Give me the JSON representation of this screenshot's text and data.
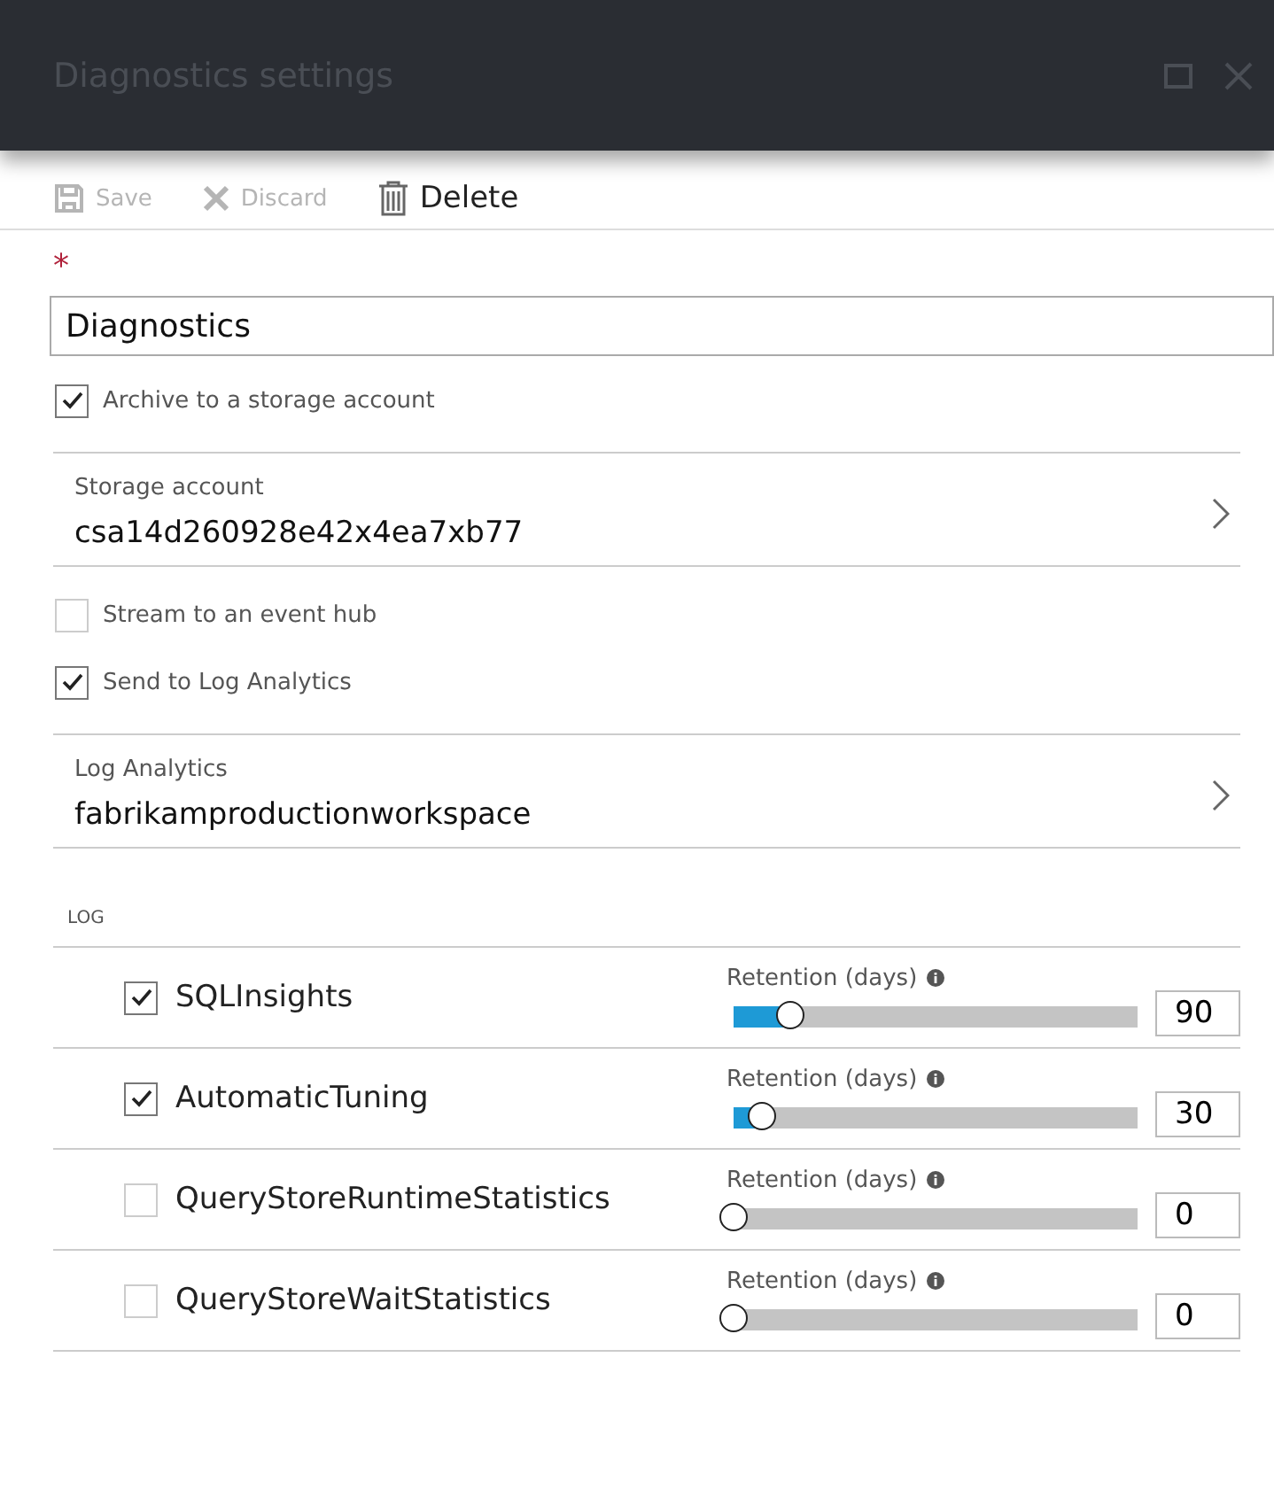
{
  "window": {
    "title": "Diagnostics settings"
  },
  "toolbar": [
    {
      "label": "Save",
      "kind": "save",
      "disabled": true
    },
    {
      "label": "Discard",
      "kind": "discard",
      "disabled": true
    },
    {
      "label": "Delete",
      "kind": "delete",
      "disabled": false
    }
  ],
  "name_field": {
    "required_mark": "*",
    "value": "Diagnostics"
  },
  "destinations": [
    {
      "kind": "checkbox",
      "label": "Archive to a storage account",
      "checked": true
    },
    {
      "kind": "picker",
      "label": "Storage account",
      "value": "csa14d260928e42x4ea7xb77"
    },
    {
      "kind": "checkbox",
      "label": "Stream to an event hub",
      "checked": false
    },
    {
      "kind": "checkbox",
      "label": "Send to Log Analytics",
      "checked": true
    },
    {
      "kind": "picker",
      "label": "Log Analytics",
      "value": "fabrikamproductionworkspace"
    }
  ],
  "log": {
    "heading": "LOG",
    "rows": [
      {
        "name": "SQLInsights",
        "checked": true,
        "retention_label": "Retention (days)",
        "level": 0.14,
        "days": "90"
      },
      {
        "name": "AutomaticTuning",
        "checked": true,
        "retention_label": "Retention (days)",
        "level": 0.07,
        "days": "30"
      },
      {
        "name": "QueryStoreRuntimeStatistics",
        "checked": false,
        "retention_label": "Retention (days)",
        "level": 0,
        "days": "0"
      },
      {
        "name": "QueryStoreWaitStatistics",
        "checked": false,
        "retention_label": "Retention (days)",
        "level": 0,
        "days": "0"
      }
    ]
  }
}
